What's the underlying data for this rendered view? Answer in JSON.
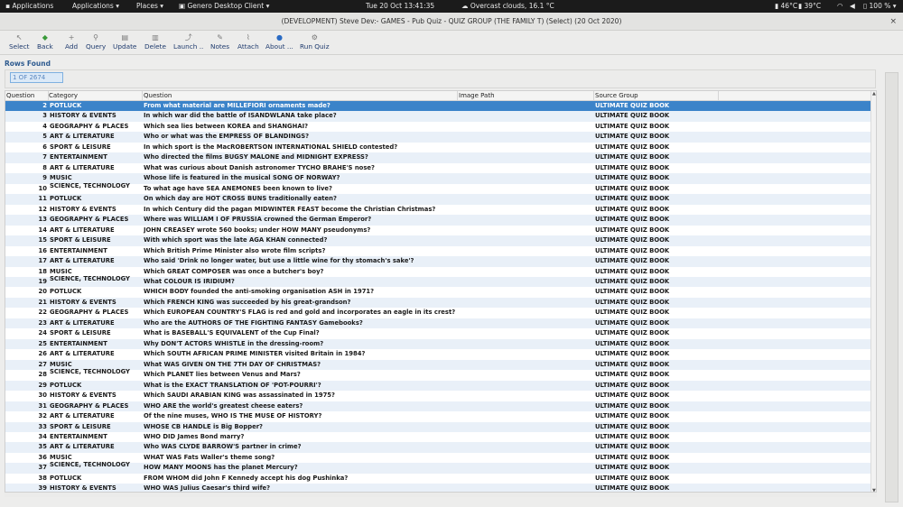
{
  "topbar": {
    "activities": "Applications",
    "applications_menu": "Applications",
    "places_menu": "Places",
    "app_menu": "Genero Desktop Client",
    "datetime": "Tue 20 Oct  13:41:35",
    "weather": "Overcast clouds, 16.1 °C",
    "temp1": "46°C",
    "temp2": "39°C",
    "battery": "100 %"
  },
  "window": {
    "title": "(DEVELOPMENT) Steve Dev:-  GAMES - Pub Quiz - QUIZ GROUP (THE FAMILY T) (Select) (20 Oct 2020)",
    "close": "×"
  },
  "toolbar": {
    "items": [
      {
        "label": "Select",
        "icon": "cursor-icon"
      },
      {
        "label": "Back",
        "icon": "back-icon"
      },
      {
        "label": "Add",
        "icon": "plus-icon"
      },
      {
        "label": "Query",
        "icon": "search-icon"
      },
      {
        "label": "Update",
        "icon": "update-icon"
      },
      {
        "label": "Delete",
        "icon": "trash-icon"
      },
      {
        "label": "Launch ..",
        "icon": "launch-icon"
      },
      {
        "label": "Notes",
        "icon": "notes-icon"
      },
      {
        "label": "Attach",
        "icon": "paperclip-icon"
      },
      {
        "label": "About ...",
        "icon": "info-icon"
      },
      {
        "label": "Run Quiz",
        "icon": "gear-icon"
      }
    ]
  },
  "rows_found_label": "Rows Found",
  "counter": "1 OF 2674",
  "grid": {
    "columns": [
      "Question",
      "Category",
      "Question",
      "Image Path",
      "Source Group"
    ],
    "rows": [
      {
        "id": "2",
        "category": "POTLUCK",
        "question": "From what material are MILLEFIORI ornaments made?",
        "source": "ULTIMATE QUIZ BOOK"
      },
      {
        "id": "3",
        "category": "HISTORY & EVENTS",
        "question": "In which war did the battle of ISANDWLANA take place?",
        "source": "ULTIMATE QUIZ BOOK"
      },
      {
        "id": "4",
        "category": "GEOGRAPHY & PLACES",
        "question": "Which sea lies between KOREA and SHANGHAI?",
        "source": "ULTIMATE QUIZ BOOK"
      },
      {
        "id": "5",
        "category": "ART & LITERATURE",
        "question": "Who or what was the EMPRESS OF BLANDINGS?",
        "source": "ULTIMATE QUIZ BOOK"
      },
      {
        "id": "6",
        "category": "SPORT & LEISURE",
        "question": "In which sport is the MacROBERTSON INTERNATIONAL SHIELD  contested?",
        "source": "ULTIMATE QUIZ BOOK"
      },
      {
        "id": "7",
        "category": "ENTERTAINMENT",
        "question": "Who directed the films BUGSY MALONE and MIDNIGHT EXPRESS?",
        "source": "ULTIMATE QUIZ BOOK"
      },
      {
        "id": "8",
        "category": "ART & LITERATURE",
        "question": "What was curious about Danish astronomer TYCHO BRAHE'S nose?",
        "source": "ULTIMATE QUIZ BOOK"
      },
      {
        "id": "9",
        "category": "MUSIC",
        "question": "Whose life is featured in the musical SONG OF NORWAY?",
        "source": "ULTIMATE QUIZ BOOK"
      },
      {
        "id": "10",
        "category": "SCIENCE, TECHNOLOGY",
        "question": "To what age have SEA ANEMONES been known to live?",
        "source": "ULTIMATE QUIZ BOOK"
      },
      {
        "id": "11",
        "category": "POTLUCK",
        "question": "On which day are HOT CROSS BUNS traditionally eaten?",
        "source": "ULTIMATE QUIZ BOOK"
      },
      {
        "id": "12",
        "category": "HISTORY & EVENTS",
        "question": "In which Century did the pagan MIDWINTER FEAST become the Christian Christmas?",
        "source": "ULTIMATE QUIZ BOOK"
      },
      {
        "id": "13",
        "category": "GEOGRAPHY & PLACES",
        "question": "Where was WILLIAM I OF PRUSSIA crowned the German Emperor?",
        "source": "ULTIMATE QUIZ BOOK"
      },
      {
        "id": "14",
        "category": "ART & LITERATURE",
        "question": "JOHN CREASEY wrote 560 books; under HOW MANY pseudonyms?",
        "source": "ULTIMATE QUIZ BOOK"
      },
      {
        "id": "15",
        "category": "SPORT & LEISURE",
        "question": "With which sport was the late AGA KHAN connected?",
        "source": "ULTIMATE QUIZ BOOK"
      },
      {
        "id": "16",
        "category": "ENTERTAINMENT",
        "question": "Which British Prime Minister also wrote film scripts?",
        "source": "ULTIMATE QUIZ BOOK"
      },
      {
        "id": "17",
        "category": "ART & LITERATURE",
        "question": "Who said 'Drink no longer water, but use a little wine for thy stomach's sake'?",
        "source": "ULTIMATE QUIZ BOOK"
      },
      {
        "id": "18",
        "category": "MUSIC",
        "question": "Which GREAT COMPOSER was once a butcher's boy?",
        "source": "ULTIMATE QUIZ BOOK"
      },
      {
        "id": "19",
        "category": "SCIENCE, TECHNOLOGY",
        "question": "What COLOUR IS IRIDIUM?",
        "source": "ULTIMATE QUIZ BOOK"
      },
      {
        "id": "20",
        "category": "POTLUCK",
        "question": "WHICH BODY founded the anti-smoking organisation ASH in 1971?",
        "source": "ULTIMATE QUIZ BOOK"
      },
      {
        "id": "21",
        "category": "HISTORY & EVENTS",
        "question": "Which FRENCH KING was succeeded by his great-grandson?",
        "source": "ULTIMATE QUIZ BOOK"
      },
      {
        "id": "22",
        "category": "GEOGRAPHY & PLACES",
        "question": "Which EUROPEAN COUNTRY'S FLAG is red and gold and incorporates an eagle in its crest?",
        "source": "ULTIMATE QUIZ BOOK"
      },
      {
        "id": "23",
        "category": "ART & LITERATURE",
        "question": "Who are the AUTHORS OF THE FIGHTING FANTASY Gamebooks?",
        "source": "ULTIMATE QUIZ BOOK"
      },
      {
        "id": "24",
        "category": "SPORT & LEISURE",
        "question": "What is BASEBALL'S EQUIVALENT of the Cup Final?",
        "source": "ULTIMATE QUIZ BOOK"
      },
      {
        "id": "25",
        "category": "ENTERTAINMENT",
        "question": "Why DON'T ACTORS WHISTLE in the dressing-room?",
        "source": "ULTIMATE QUIZ BOOK"
      },
      {
        "id": "26",
        "category": "ART & LITERATURE",
        "question": "Which SOUTH AFRICAN PRIME MINISTER visited Britain in 1984?",
        "source": "ULTIMATE QUIZ BOOK"
      },
      {
        "id": "27",
        "category": "MUSIC",
        "question": "What WAS GIVEN ON THE 7TH DAY OF CHRISTMAS?",
        "source": "ULTIMATE QUIZ BOOK"
      },
      {
        "id": "28",
        "category": "SCIENCE, TECHNOLOGY",
        "question": "Which PLANET lies between Venus and Mars?",
        "source": "ULTIMATE QUIZ BOOK"
      },
      {
        "id": "29",
        "category": "POTLUCK",
        "question": "What is the EXACT TRANSLATION OF 'POT-POURRI'?",
        "source": "ULTIMATE QUIZ BOOK"
      },
      {
        "id": "30",
        "category": "HISTORY & EVENTS",
        "question": "Which SAUDI ARABIAN KING was assassinated in 1975?",
        "source": "ULTIMATE QUIZ BOOK"
      },
      {
        "id": "31",
        "category": "GEOGRAPHY & PLACES",
        "question": "WHO ARE the world's greatest cheese eaters?",
        "source": "ULTIMATE QUIZ BOOK"
      },
      {
        "id": "32",
        "category": "ART & LITERATURE",
        "question": "Of the nine muses, WHO IS THE MUSE OF HISTORY?",
        "source": "ULTIMATE QUIZ BOOK"
      },
      {
        "id": "33",
        "category": "SPORT & LEISURE",
        "question": "WHOSE CB HANDLE is Big Bopper?",
        "source": "ULTIMATE QUIZ BOOK"
      },
      {
        "id": "34",
        "category": "ENTERTAINMENT",
        "question": "WHO DID James Bond marry?",
        "source": "ULTIMATE QUIZ BOOK"
      },
      {
        "id": "35",
        "category": "ART & LITERATURE",
        "question": "Who WAS CLYDE BARROW'S partner in crime?",
        "source": "ULTIMATE QUIZ BOOK"
      },
      {
        "id": "36",
        "category": "MUSIC",
        "question": "WHAT WAS Fats Waller's theme song?",
        "source": "ULTIMATE QUIZ BOOK"
      },
      {
        "id": "37",
        "category": "SCIENCE, TECHNOLOGY",
        "question": "HOW MANY MOONS has the planet Mercury?",
        "source": "ULTIMATE QUIZ BOOK"
      },
      {
        "id": "38",
        "category": "POTLUCK",
        "question": "FROM WHOM did John F Kennedy accept his dog Pushinka?",
        "source": "ULTIMATE QUIZ BOOK"
      },
      {
        "id": "39",
        "category": "HISTORY & EVENTS",
        "question": "WHO WAS Julius Caesar's third wife?",
        "source": "ULTIMATE QUIZ BOOK"
      }
    ]
  },
  "colors": {
    "selection": "#3b83c9",
    "alt_row": "#e9f0f8",
    "topbar": "#1b1b1b"
  }
}
